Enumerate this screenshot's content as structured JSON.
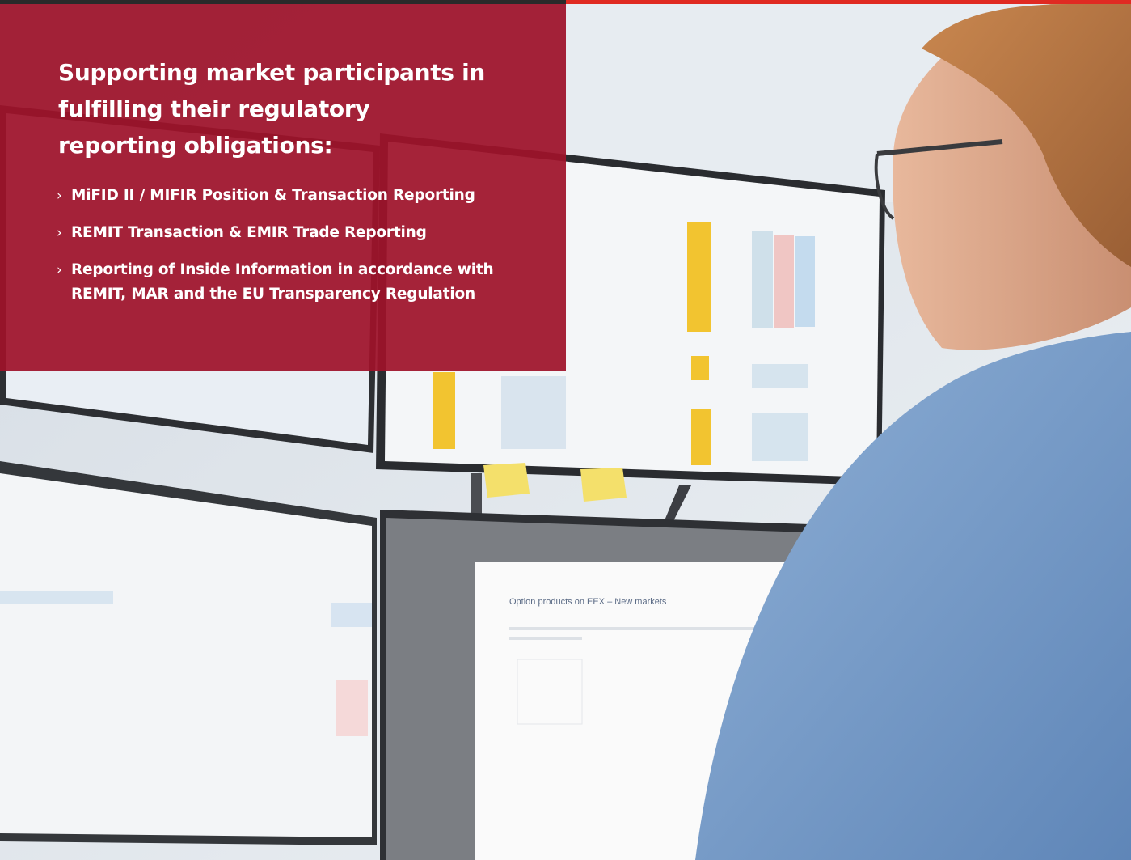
{
  "colors": {
    "overlay": "#9e122a",
    "accent_strip": "#e02a22",
    "text": "#ffffff"
  },
  "overlay": {
    "heading": "Supporting market participants in fulfilling their regulatory reporting obligations:",
    "bullet_marker": "›",
    "bullets": [
      "MiFID II / MIFIR Position & Transaction Reporting",
      "REMIT Transaction & EMIR Trade Reporting",
      "Reporting of Inside Information in accordance with REMIT, MAR and the EU Transparency Regulation"
    ]
  },
  "photo": {
    "screen_heading": "Option products on EEX – New markets"
  }
}
